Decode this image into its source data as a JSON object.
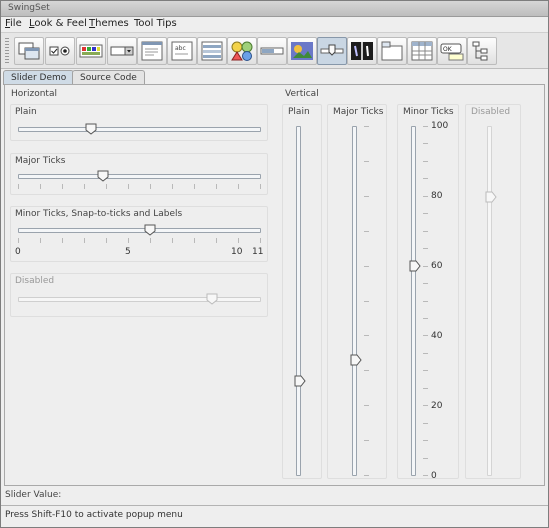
{
  "window": {
    "title": "SwingSet"
  },
  "menubar": {
    "items": [
      {
        "mnemonic": "F",
        "rest": "ile"
      },
      {
        "mnemonic": "L",
        "rest": "ook & Feel"
      },
      {
        "mnemonic": "T",
        "rest": "hemes"
      },
      {
        "mnemonic": "",
        "rest": "Tool Tips"
      }
    ]
  },
  "toolbar": {
    "buttons": [
      {
        "icon": "internal-frame-icon"
      },
      {
        "icon": "checkbox-radio-icon"
      },
      {
        "icon": "color-chooser-icon"
      },
      {
        "icon": "combobox-icon"
      },
      {
        "icon": "file-chooser-icon"
      },
      {
        "icon": "html-editor-icon"
      },
      {
        "icon": "list-icon"
      },
      {
        "icon": "option-pane-icon"
      },
      {
        "icon": "progress-bar-icon"
      },
      {
        "icon": "scroll-pane-icon"
      },
      {
        "icon": "slider-icon",
        "selected": true
      },
      {
        "icon": "split-pane-icon"
      },
      {
        "icon": "tabbed-pane-icon"
      },
      {
        "icon": "table-icon"
      },
      {
        "icon": "tooltip-icon"
      },
      {
        "icon": "tree-icon"
      }
    ]
  },
  "tabs": [
    {
      "label": "Slider Demo",
      "active": true
    },
    {
      "label": "Source Code",
      "active": false
    }
  ],
  "horizontal": {
    "title": "Horizontal",
    "plain": {
      "label": "Plain",
      "value": 0.3
    },
    "major": {
      "label": "Major Ticks",
      "value": 0.35
    },
    "minor": {
      "label": "Minor Ticks, Snap-to-ticks and Labels",
      "value": 6,
      "max": 11,
      "tick_labels": [
        "0",
        "5",
        "10",
        "11"
      ]
    },
    "disabled": {
      "label": "Disabled",
      "value": 0.8
    }
  },
  "vertical": {
    "title": "Vertical",
    "plain": {
      "label": "Plain",
      "value": 0.27
    },
    "major": {
      "label": "Major Ticks",
      "value": 0.33
    },
    "minor": {
      "label": "Minor Ticks",
      "value": 60,
      "tick_labels": [
        "100",
        "80",
        "60",
        "40",
        "20",
        "0"
      ]
    },
    "disabled": {
      "label": "Disabled",
      "value": 0.8
    }
  },
  "status": {
    "slider_value": "Slider Value:",
    "hint": "Press Shift-F10 to activate popup menu"
  },
  "colors": {
    "accent": "#cfdbe6",
    "thumb": "#f7f7f7",
    "track": "#f4f6f8"
  }
}
